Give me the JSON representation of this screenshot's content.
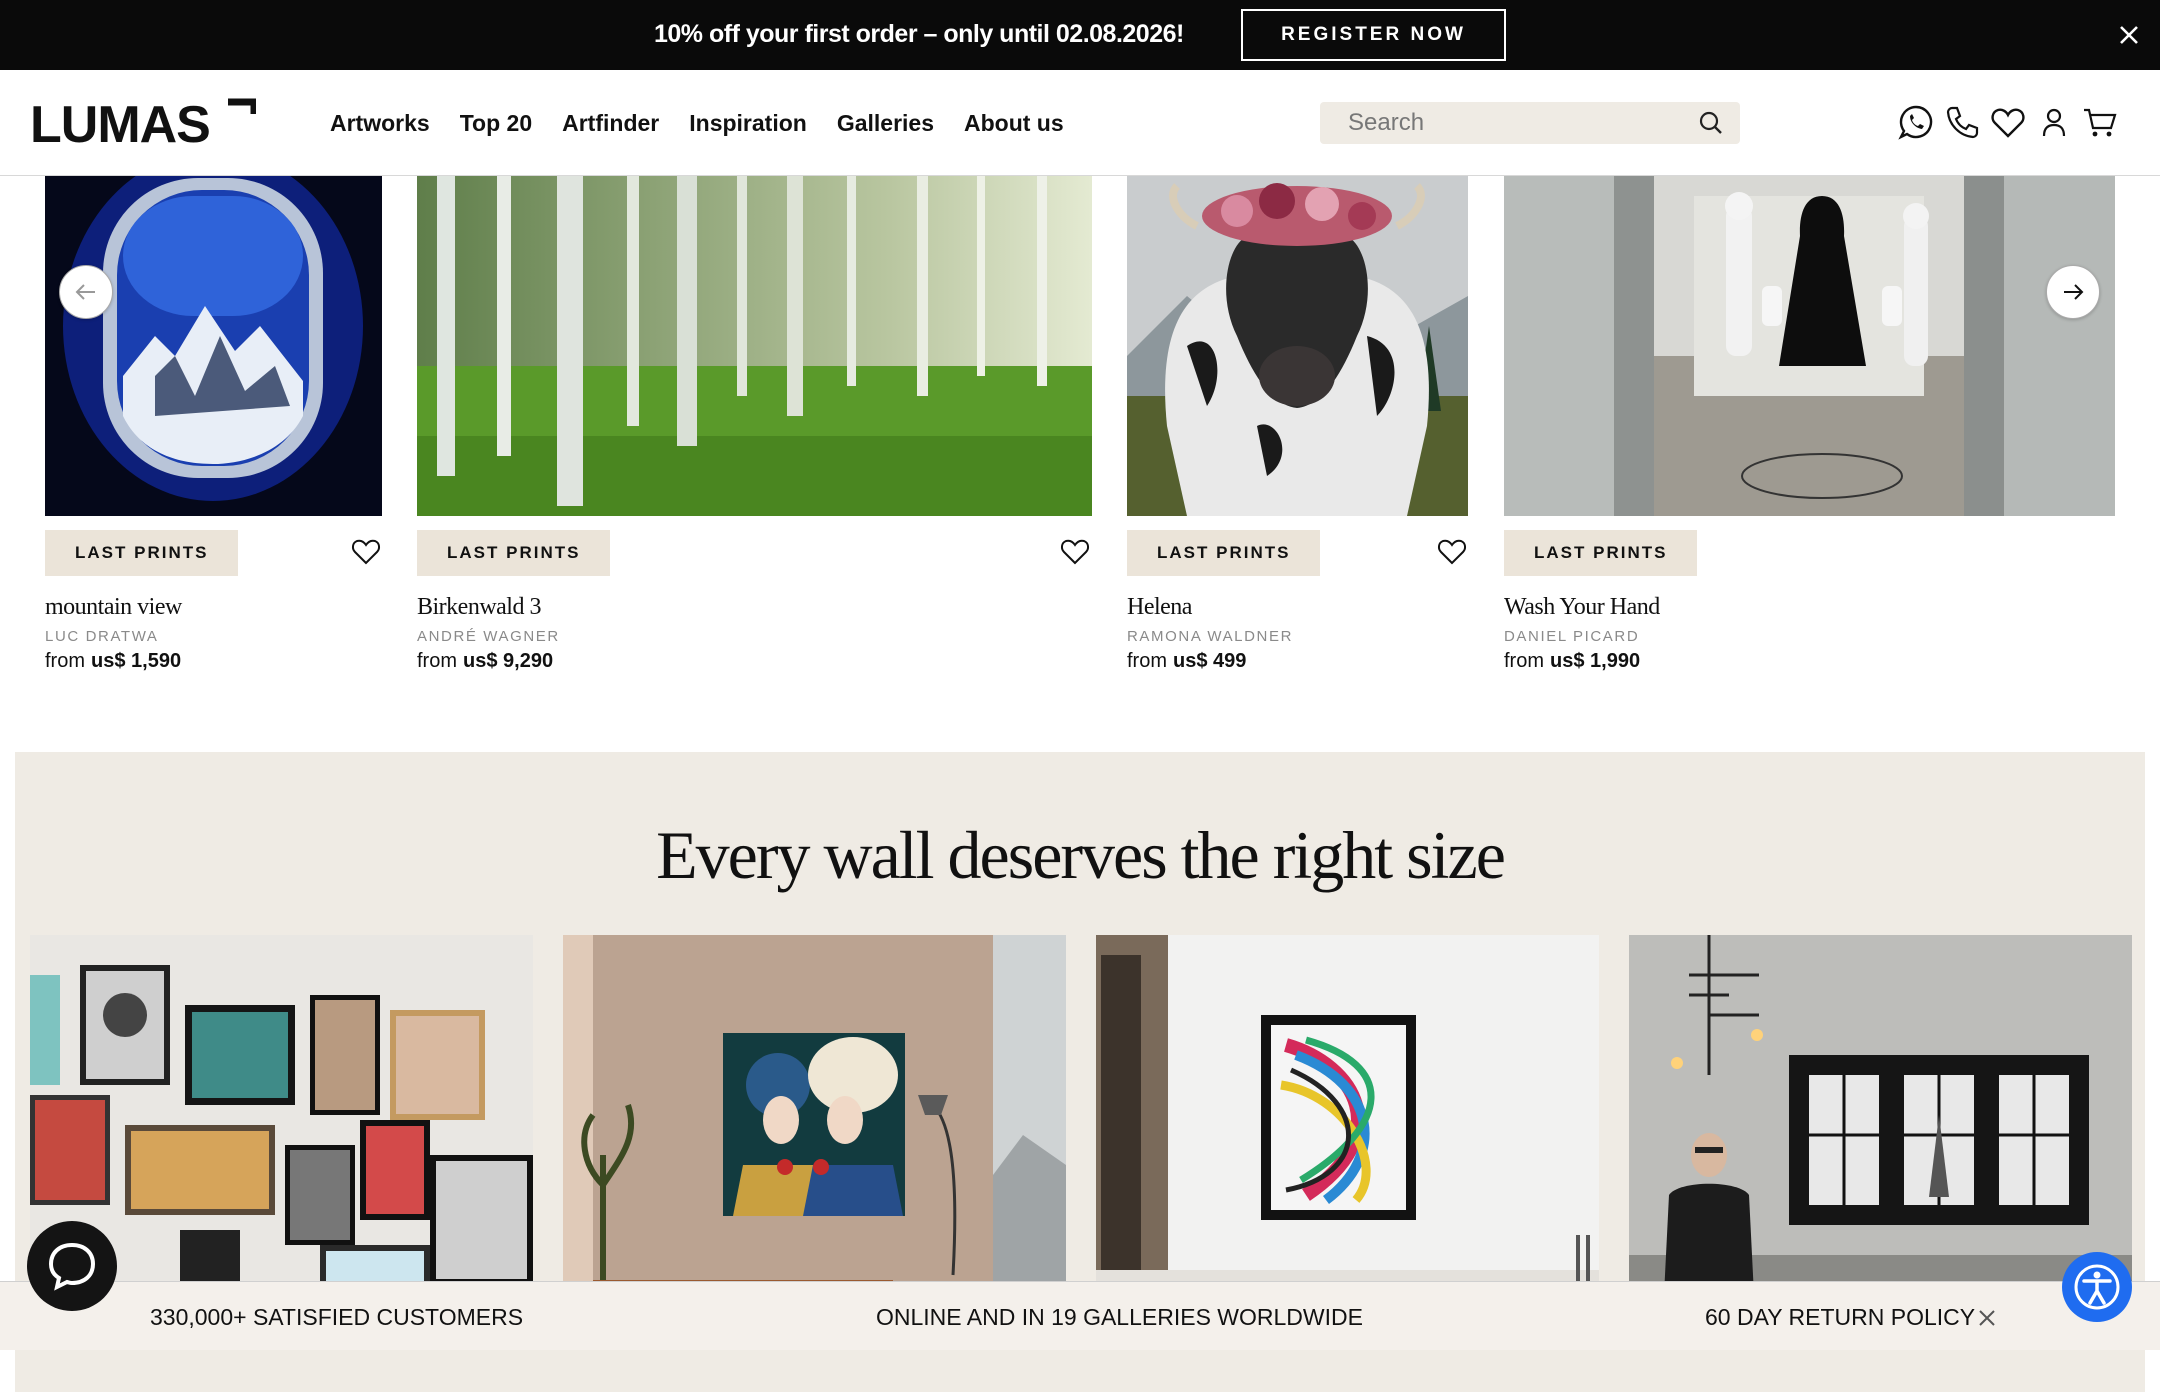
{
  "promo": {
    "text": "10% off your first order – only until 02.08.2026!",
    "button": "REGISTER NOW",
    "close_icon": "close-icon"
  },
  "header": {
    "logo": "LUMAS",
    "nav": [
      "Artworks",
      "Top 20",
      "Artfinder",
      "Inspiration",
      "Galleries",
      "About us"
    ],
    "search_placeholder": "Search",
    "icons": [
      "whatsapp-icon",
      "phone-icon",
      "heart-icon",
      "user-icon",
      "cart-icon"
    ]
  },
  "carousel": {
    "prev_icon": "arrow-left-icon",
    "next_icon": "arrow-right-icon",
    "items": [
      {
        "badge": "LAST PRINTS",
        "title": "mountain view",
        "artist": "LUC DRATWA",
        "price_prefix": "from",
        "price": "us$ 1,590"
      },
      {
        "badge": "LAST PRINTS",
        "title": "Birkenwald 3",
        "artist": "ANDRÉ WAGNER",
        "price_prefix": "from",
        "price": "us$ 9,290"
      },
      {
        "badge": "LAST PRINTS",
        "title": "Helena",
        "artist": "RAMONA WALDNER",
        "price_prefix": "from",
        "price": "us$ 499"
      },
      {
        "badge": "LAST PRINTS",
        "title": "Wash Your Hand",
        "artist": "DANIEL PICARD",
        "price_prefix": "from",
        "price": "us$ 1,990"
      }
    ]
  },
  "size_section": {
    "heading": "Every wall deserves the right size"
  },
  "bottom_bar": {
    "items": [
      "330,000+ SATISFIED CUSTOMERS",
      "ONLINE AND IN 19 GALLERIES WORLDWIDE",
      "60 DAY RETURN POLICY"
    ]
  },
  "colors": {
    "promo_bg": "#0a0a0a",
    "badge_bg": "#ebe4d9",
    "section_bg": "#efebe4",
    "accessibility_blue": "#1f6cf0"
  }
}
